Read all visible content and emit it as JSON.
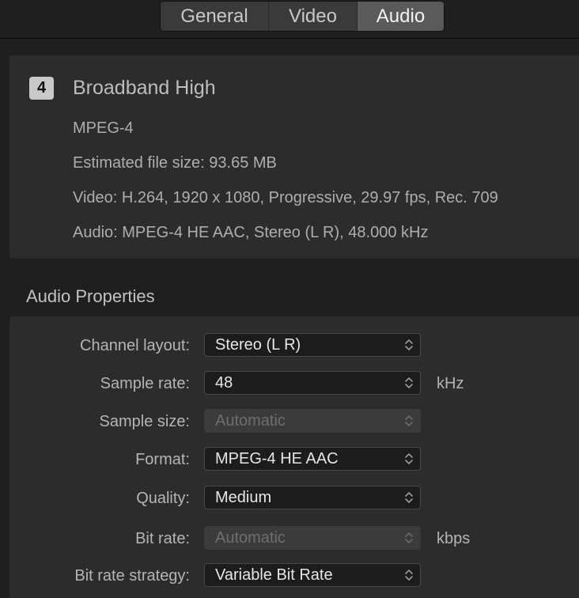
{
  "tabs": {
    "general": "General",
    "video": "Video",
    "audio": "Audio",
    "selected": "Audio"
  },
  "summary": {
    "badge": "4",
    "title": "Broadband High",
    "format": "MPEG-4",
    "file_size": "Estimated file size: 93.65 MB",
    "video": "Video: H.264, 1920 x 1080, Progressive, 29.97 fps, Rec. 709",
    "audio": "Audio: MPEG-4 HE AAC, Stereo (L R), 48.000 kHz"
  },
  "audio_properties": {
    "heading": "Audio Properties",
    "channel_layout": {
      "label": "Channel layout:",
      "value": "Stereo (L R)"
    },
    "sample_rate": {
      "label": "Sample rate:",
      "value": "48",
      "unit": "kHz"
    },
    "sample_size": {
      "label": "Sample size:",
      "value": "Automatic"
    },
    "format": {
      "label": "Format:",
      "value": "MPEG-4 HE AAC"
    },
    "quality": {
      "label": "Quality:",
      "value": "Medium"
    },
    "bit_rate": {
      "label": "Bit rate:",
      "value": "Automatic",
      "unit": "kbps"
    },
    "bit_rate_strategy": {
      "label": "Bit rate strategy:",
      "value": "Variable Bit Rate"
    }
  },
  "icons": {
    "popup_chevron": "up-down-chevron-icon"
  },
  "colors": {
    "background": "#1f1f1f",
    "panel": "#2c2c2c",
    "selected_tab": "#5a5a5a",
    "popup": "#1c1c1c",
    "disabled_popup": "#3b3b3b"
  }
}
